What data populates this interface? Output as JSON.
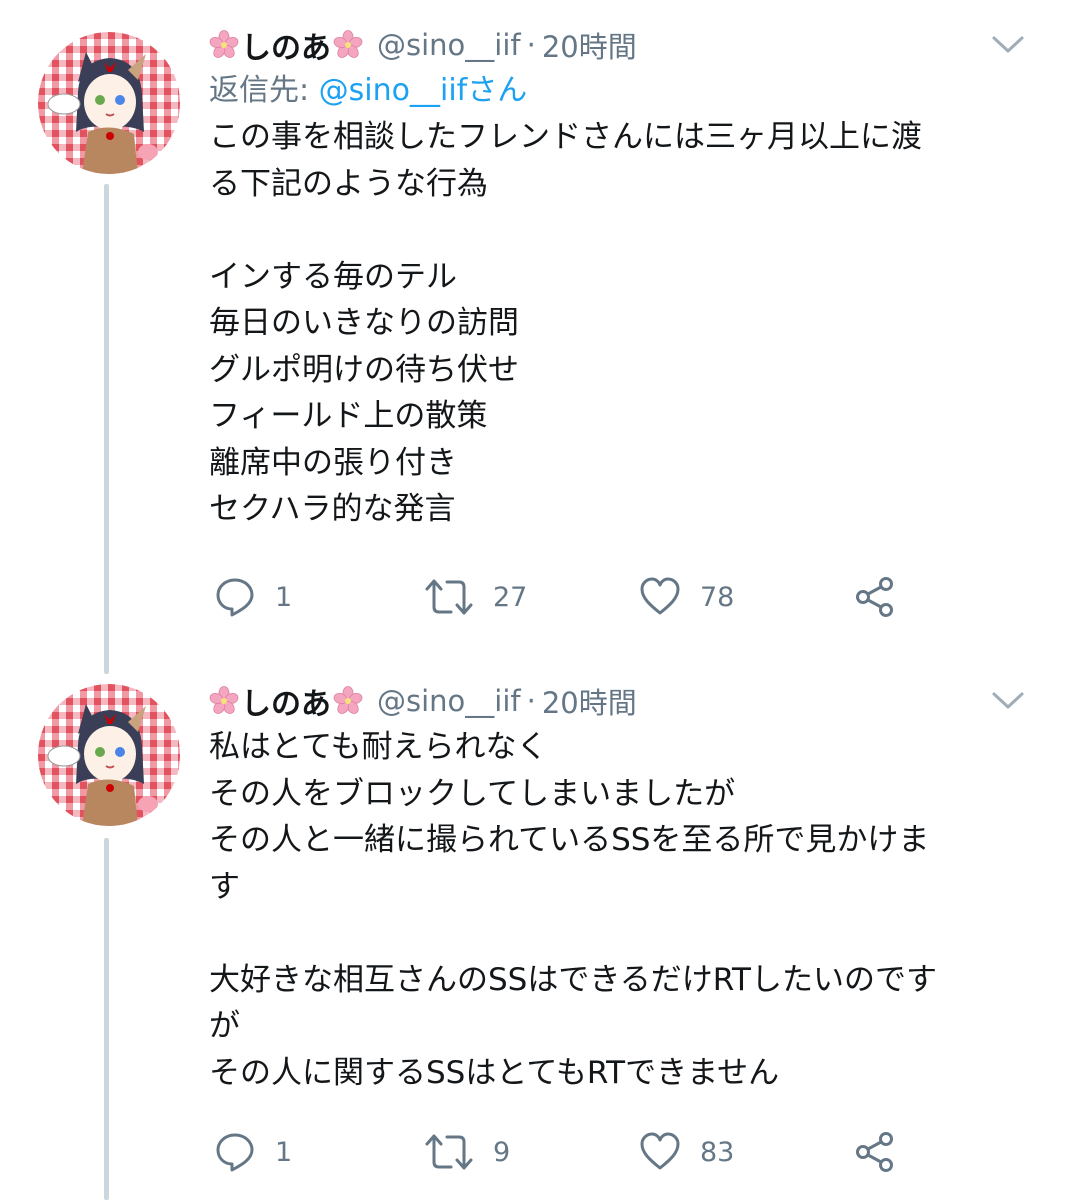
{
  "tweets": [
    {
      "display_name": "しのあ",
      "handle": "@sino__iif",
      "separator": "·",
      "time": "20時間",
      "reply_label": "返信先: ",
      "reply_mention": "@sino__iifさん",
      "text_lines": [
        "この事を相談したフレンドさんには三ヶ月以上に渡",
        "る下記のような行為",
        "",
        "インする毎のテル",
        "毎日のいきなりの訪問",
        "グルポ明けの待ち伏せ",
        "フィールド上の散策",
        "離席中の張り付き",
        "セクハラ的な発言"
      ],
      "counts": {
        "replies": "1",
        "retweets": "27",
        "likes": "78"
      }
    },
    {
      "display_name": "しのあ",
      "handle": "@sino__iif",
      "separator": "·",
      "time": "20時間",
      "text_lines": [
        "私はとても耐えられなく",
        "その人をブロックしてしまいましたが",
        "その人と一緒に撮られているSSを至る所で見かけま",
        "す",
        "",
        "大好きな相互さんのSSはできるだけRTしたいのです",
        "が",
        "その人に関するSSはとてもRTできません"
      ],
      "counts": {
        "replies": "1",
        "retweets": "9",
        "likes": "83"
      }
    }
  ],
  "icons": {
    "name_emoji": "cherry-blossom-icon",
    "menu": "chevron-down-icon",
    "reply": "reply-bubble-icon",
    "retweet": "retweet-icon",
    "like": "heart-icon",
    "share": "share-icon"
  },
  "colors": {
    "text": "#14171a",
    "secondary": "#657786",
    "link": "#1da1f2",
    "thread_line": "#ccd6dd",
    "blossom": "#f4a6c0"
  }
}
